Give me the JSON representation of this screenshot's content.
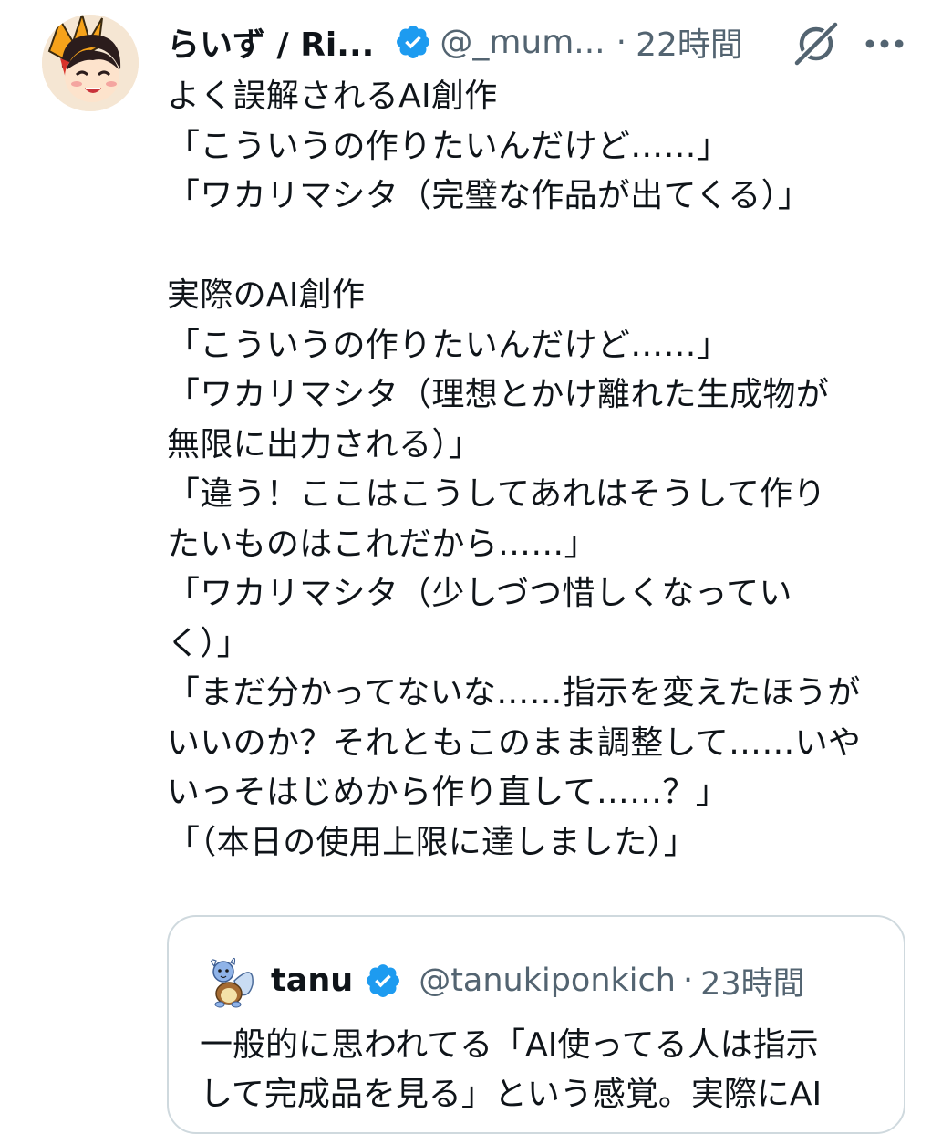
{
  "tweet": {
    "display_name": "らいず / Ri...",
    "handle": "@_mum...",
    "separator": "·",
    "time": "22時間",
    "body": "よく誤解されるAI創作\n「こういうの作りたいんだけど……」\n「ワカリマシタ（完璧な作品が出てくる）」\n\n実際のAI創作\n「こういうの作りたいんだけど……」\n「ワカリマシタ（理想とかけ離れた生成物が\n無限に出力される）」\n「違う！ここはこうしてあれはそうして作り\nたいものはこれだから……」\n「ワカリマシタ（少しづつ惜しくなってい\nく）」\n「まだ分かってないな……指示を変えたほうが\nいいのか？それともこのまま調整して……いや\nいっそはじめから作り直して……？」\n「（本日の使用上限に達しました）」",
    "icons": {
      "verified": "verified-badge-icon",
      "grok": "grok-icon",
      "more": "more-options-icon"
    }
  },
  "quoted_tweet": {
    "display_name": "tanu",
    "handle": "@tanukiponkich",
    "separator": "·",
    "time": "23時間",
    "body": "一般的に思われてる「AI使ってる人は指示\nして完成品を見る」という感覚。実際にAI"
  },
  "colors": {
    "text": "#0f1419",
    "secondary": "#536471",
    "verified_blue": "#1d9bf0",
    "border": "#cfd9de"
  }
}
